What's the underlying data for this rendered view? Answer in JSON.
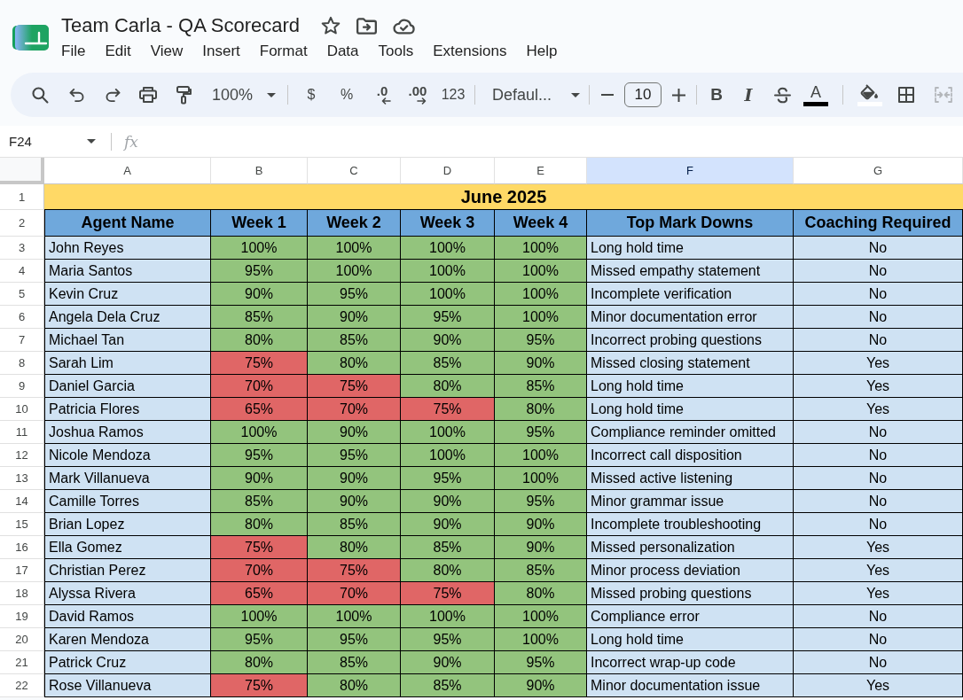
{
  "document": {
    "title": "Team Carla - QA Scorecard"
  },
  "menu": [
    "File",
    "Edit",
    "View",
    "Insert",
    "Format",
    "Data",
    "Tools",
    "Extensions",
    "Help"
  ],
  "toolbar": {
    "zoom": "100%",
    "currency": "$",
    "percent": "%",
    "decrease_decimal": ".0",
    "increase_decimal": ".00",
    "number_format": "123",
    "font": "Defaul...",
    "font_size": "10",
    "bold": "B",
    "italic": "I",
    "text_color": "A",
    "merge": {
      "disabled": true
    }
  },
  "formula_bar": {
    "name_box": "F24",
    "function_label": "fx"
  },
  "sheet": {
    "column_headers": [
      {
        "label": "A",
        "selected": false
      },
      {
        "label": "B",
        "selected": false
      },
      {
        "label": "C",
        "selected": false
      },
      {
        "label": "D",
        "selected": false
      },
      {
        "label": "E",
        "selected": false
      },
      {
        "label": "F",
        "selected": true
      },
      {
        "label": "G",
        "selected": false
      }
    ],
    "title_row": {
      "row_number": "1",
      "text": "June 2025"
    },
    "header_row": {
      "row_number": "2",
      "cells": [
        "Agent Name",
        "Week 1",
        "Week 2",
        "Week 3",
        "Week 4",
        "Top Mark Downs",
        "Coaching Required"
      ]
    },
    "rows": [
      {
        "row_number": "3",
        "agent": "John Reyes",
        "scores": [
          {
            "value": "100%",
            "color": "#93c47d"
          },
          {
            "value": "100%",
            "color": "#93c47d"
          },
          {
            "value": "100%",
            "color": "#93c47d"
          },
          {
            "value": "100%",
            "color": "#93c47d"
          }
        ],
        "top_mark_down": "Long hold time",
        "coaching_required": "No"
      },
      {
        "row_number": "4",
        "agent": "Maria Santos",
        "scores": [
          {
            "value": "95%",
            "color": "#93c47d"
          },
          {
            "value": "100%",
            "color": "#93c47d"
          },
          {
            "value": "100%",
            "color": "#93c47d"
          },
          {
            "value": "100%",
            "color": "#93c47d"
          }
        ],
        "top_mark_down": "Missed empathy statement",
        "coaching_required": "No"
      },
      {
        "row_number": "5",
        "agent": "Kevin Cruz",
        "scores": [
          {
            "value": "90%",
            "color": "#93c47d"
          },
          {
            "value": "95%",
            "color": "#93c47d"
          },
          {
            "value": "100%",
            "color": "#93c47d"
          },
          {
            "value": "100%",
            "color": "#93c47d"
          }
        ],
        "top_mark_down": "Incomplete verification",
        "coaching_required": "No"
      },
      {
        "row_number": "6",
        "agent": "Angela Dela Cruz",
        "scores": [
          {
            "value": "85%",
            "color": "#93c47d"
          },
          {
            "value": "90%",
            "color": "#93c47d"
          },
          {
            "value": "95%",
            "color": "#93c47d"
          },
          {
            "value": "100%",
            "color": "#93c47d"
          }
        ],
        "top_mark_down": "Minor documentation error",
        "coaching_required": "No"
      },
      {
        "row_number": "7",
        "agent": "Michael Tan",
        "scores": [
          {
            "value": "80%",
            "color": "#93c47d"
          },
          {
            "value": "85%",
            "color": "#93c47d"
          },
          {
            "value": "90%",
            "color": "#93c47d"
          },
          {
            "value": "95%",
            "color": "#93c47d"
          }
        ],
        "top_mark_down": "Incorrect probing questions",
        "coaching_required": "No"
      },
      {
        "row_number": "8",
        "agent": "Sarah Lim",
        "scores": [
          {
            "value": "75%",
            "color": "#e06666"
          },
          {
            "value": "80%",
            "color": "#93c47d"
          },
          {
            "value": "85%",
            "color": "#93c47d"
          },
          {
            "value": "90%",
            "color": "#93c47d"
          }
        ],
        "top_mark_down": "Missed closing statement",
        "coaching_required": "Yes"
      },
      {
        "row_number": "9",
        "agent": "Daniel Garcia",
        "scores": [
          {
            "value": "70%",
            "color": "#e06666"
          },
          {
            "value": "75%",
            "color": "#e06666"
          },
          {
            "value": "80%",
            "color": "#93c47d"
          },
          {
            "value": "85%",
            "color": "#93c47d"
          }
        ],
        "top_mark_down": "Long hold time",
        "coaching_required": "Yes"
      },
      {
        "row_number": "10",
        "agent": "Patricia Flores",
        "scores": [
          {
            "value": "65%",
            "color": "#e06666"
          },
          {
            "value": "70%",
            "color": "#e06666"
          },
          {
            "value": "75%",
            "color": "#e06666"
          },
          {
            "value": "80%",
            "color": "#93c47d"
          }
        ],
        "top_mark_down": "Long hold time",
        "coaching_required": "Yes"
      },
      {
        "row_number": "11",
        "agent": "Joshua Ramos",
        "scores": [
          {
            "value": "100%",
            "color": "#93c47d"
          },
          {
            "value": "90%",
            "color": "#93c47d"
          },
          {
            "value": "100%",
            "color": "#93c47d"
          },
          {
            "value": "95%",
            "color": "#93c47d"
          }
        ],
        "top_mark_down": "Compliance reminder omitted",
        "coaching_required": "No"
      },
      {
        "row_number": "12",
        "agent": "Nicole Mendoza",
        "scores": [
          {
            "value": "95%",
            "color": "#93c47d"
          },
          {
            "value": "95%",
            "color": "#93c47d"
          },
          {
            "value": "100%",
            "color": "#93c47d"
          },
          {
            "value": "100%",
            "color": "#93c47d"
          }
        ],
        "top_mark_down": "Incorrect call disposition",
        "coaching_required": "No"
      },
      {
        "row_number": "13",
        "agent": "Mark Villanueva",
        "scores": [
          {
            "value": "90%",
            "color": "#93c47d"
          },
          {
            "value": "90%",
            "color": "#93c47d"
          },
          {
            "value": "95%",
            "color": "#93c47d"
          },
          {
            "value": "100%",
            "color": "#93c47d"
          }
        ],
        "top_mark_down": "Missed active listening",
        "coaching_required": "No"
      },
      {
        "row_number": "14",
        "agent": "Camille Torres",
        "scores": [
          {
            "value": "85%",
            "color": "#93c47d"
          },
          {
            "value": "90%",
            "color": "#93c47d"
          },
          {
            "value": "90%",
            "color": "#93c47d"
          },
          {
            "value": "95%",
            "color": "#93c47d"
          }
        ],
        "top_mark_down": "Minor grammar issue",
        "coaching_required": "No"
      },
      {
        "row_number": "15",
        "agent": "Brian Lopez",
        "scores": [
          {
            "value": "80%",
            "color": "#93c47d"
          },
          {
            "value": "85%",
            "color": "#93c47d"
          },
          {
            "value": "90%",
            "color": "#93c47d"
          },
          {
            "value": "90%",
            "color": "#93c47d"
          }
        ],
        "top_mark_down": "Incomplete troubleshooting",
        "coaching_required": "No"
      },
      {
        "row_number": "16",
        "agent": "Ella Gomez",
        "scores": [
          {
            "value": "75%",
            "color": "#e06666"
          },
          {
            "value": "80%",
            "color": "#93c47d"
          },
          {
            "value": "85%",
            "color": "#93c47d"
          },
          {
            "value": "90%",
            "color": "#93c47d"
          }
        ],
        "top_mark_down": "Missed personalization",
        "coaching_required": "Yes"
      },
      {
        "row_number": "17",
        "agent": "Christian Perez",
        "scores": [
          {
            "value": "70%",
            "color": "#e06666"
          },
          {
            "value": "75%",
            "color": "#e06666"
          },
          {
            "value": "80%",
            "color": "#93c47d"
          },
          {
            "value": "85%",
            "color": "#93c47d"
          }
        ],
        "top_mark_down": "Minor process deviation",
        "coaching_required": "Yes"
      },
      {
        "row_number": "18",
        "agent": "Alyssa Rivera",
        "scores": [
          {
            "value": "65%",
            "color": "#e06666"
          },
          {
            "value": "70%",
            "color": "#e06666"
          },
          {
            "value": "75%",
            "color": "#e06666"
          },
          {
            "value": "80%",
            "color": "#93c47d"
          }
        ],
        "top_mark_down": "Missed probing questions",
        "coaching_required": "Yes"
      },
      {
        "row_number": "19",
        "agent": "David Ramos",
        "scores": [
          {
            "value": "100%",
            "color": "#93c47d"
          },
          {
            "value": "100%",
            "color": "#93c47d"
          },
          {
            "value": "100%",
            "color": "#93c47d"
          },
          {
            "value": "100%",
            "color": "#93c47d"
          }
        ],
        "top_mark_down": "Compliance error",
        "coaching_required": "No"
      },
      {
        "row_number": "20",
        "agent": "Karen Mendoza",
        "scores": [
          {
            "value": "95%",
            "color": "#93c47d"
          },
          {
            "value": "95%",
            "color": "#93c47d"
          },
          {
            "value": "95%",
            "color": "#93c47d"
          },
          {
            "value": "100%",
            "color": "#93c47d"
          }
        ],
        "top_mark_down": "Long hold time",
        "coaching_required": "No"
      },
      {
        "row_number": "21",
        "agent": "Patrick Cruz",
        "scores": [
          {
            "value": "80%",
            "color": "#93c47d"
          },
          {
            "value": "85%",
            "color": "#93c47d"
          },
          {
            "value": "90%",
            "color": "#93c47d"
          },
          {
            "value": "95%",
            "color": "#93c47d"
          }
        ],
        "top_mark_down": "Incorrect wrap-up code",
        "coaching_required": "No"
      },
      {
        "row_number": "22",
        "agent": "Rose Villanueva",
        "scores": [
          {
            "value": "75%",
            "color": "#e06666"
          },
          {
            "value": "80%",
            "color": "#93c47d"
          },
          {
            "value": "85%",
            "color": "#93c47d"
          },
          {
            "value": "90%",
            "color": "#93c47d"
          }
        ],
        "top_mark_down": "Minor documentation issue",
        "coaching_required": "Yes"
      }
    ]
  }
}
